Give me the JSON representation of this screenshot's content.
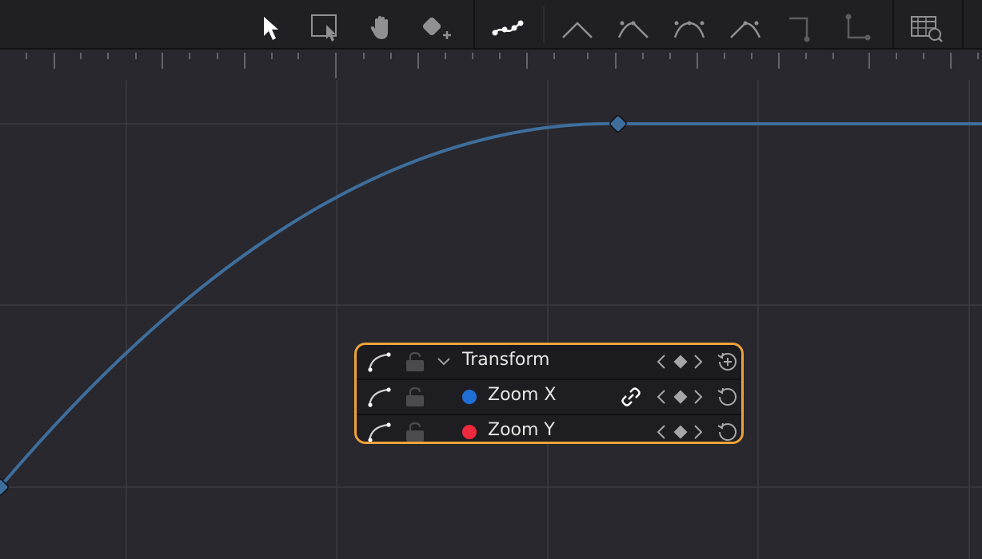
{
  "toolbar": {
    "tools": [
      {
        "name": "pointer-select-icon"
      },
      {
        "name": "marquee-select-icon"
      },
      {
        "name": "hand-pan-icon"
      },
      {
        "name": "add-keyframe-icon"
      },
      {
        "name": "curve-edit-icon"
      },
      {
        "name": "linear-interpolation-icon"
      },
      {
        "name": "ease-in-icon"
      },
      {
        "name": "ease-out-icon"
      },
      {
        "name": "ease-in-out-icon"
      },
      {
        "name": "hold-step-icon"
      },
      {
        "name": "step-end-icon"
      },
      {
        "name": "zoom-graph-icon"
      }
    ]
  },
  "curve_color": "#3e6e9c",
  "accent_color": "#f0a23a",
  "keyframe_panel": {
    "rows": [
      {
        "label": "Transform",
        "expanded": true
      },
      {
        "label": "Zoom X",
        "channel_color": "#1f6fd6",
        "linked": true
      },
      {
        "label": "Zoom Y",
        "channel_color": "#ec2a3c"
      }
    ]
  }
}
